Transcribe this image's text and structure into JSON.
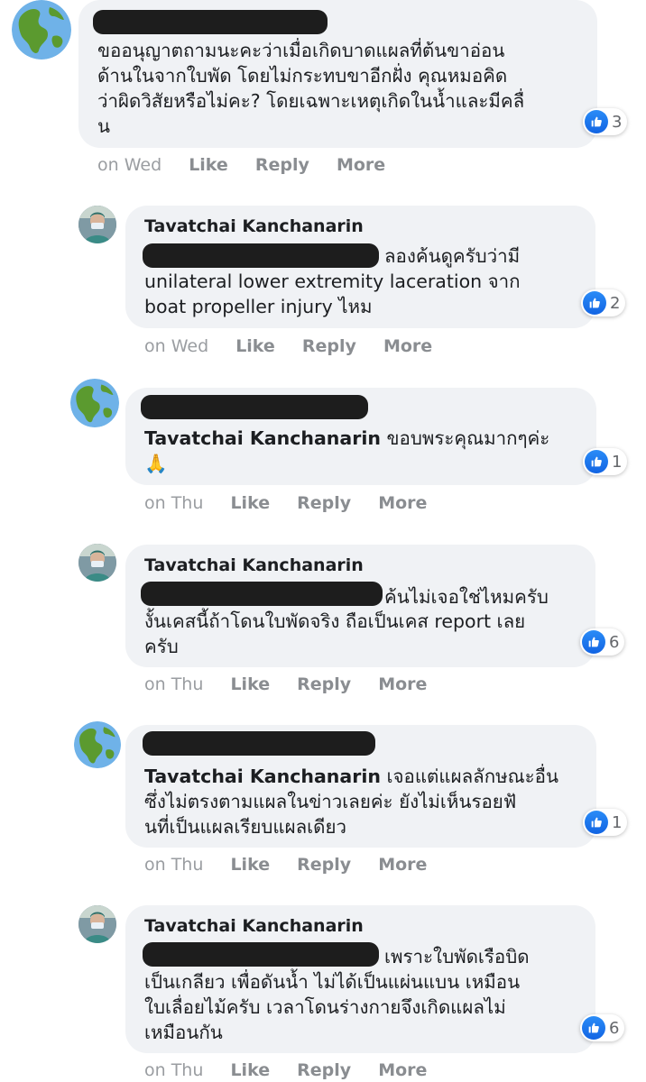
{
  "comments": [
    {
      "author": "",
      "lines": [
        "ขออนุญาตถามนะคะว่าเมื่อเกิดบาดแผลที่ต้นขาอ่อน",
        "ด้านในจากใบพัด โดยไม่กระทบขาอีกฝั่ง คุณหมอคิด",
        "ว่าผิดวิสัยหรือไม่คะ? โดยเฉพาะเหตุเกิดในน้ำและมีคลื่",
        "น"
      ],
      "reactions": "3",
      "time": "on Wed"
    },
    {
      "author": "Tavatchai Kanchanarin",
      "lines": [
        "ลองค้นดูครับว่ามี",
        "unilateral lower extremity laceration จาก",
        "boat propeller injury ไหม"
      ],
      "reactions": "2",
      "time": "on Wed"
    },
    {
      "author": "",
      "mention": "Tavatchai Kanchanarin",
      "lines": [
        "ขอบพระคุณมากๆค่ะ",
        "🙏"
      ],
      "reactions": "1",
      "time": "on Thu"
    },
    {
      "author": "Tavatchai Kanchanarin",
      "lines": [
        "ค้นไม่เจอใช่ไหมครับ",
        "งั้นเคสนี้ถ้าโดนใบพัดจริง ถือเป็นเคส report เลย",
        "ครับ"
      ],
      "reactions": "6",
      "time": "on Thu"
    },
    {
      "author": "",
      "mention": "Tavatchai Kanchanarin",
      "lines": [
        "เจอแต่แผลลักษณะอื่น",
        "ซึ่งไม่ตรงตามแผลในข่าวเลยค่ะ ยังไม่เห็นรอยฟั",
        "นที่เป็นแผลเรียบแผลเดียว"
      ],
      "reactions": "1",
      "time": "on Thu"
    },
    {
      "author": "Tavatchai Kanchanarin",
      "lines": [
        "เพราะใบพัดเรือบิด",
        "เป็นเกลียว เพื่อดันน้ำ ไม่ได้เป็นแผ่นแบน เหมือน",
        "ใบเลื่อยไม้ครับ เวลาโดนร่างกายจึงเกิดแผลไม่",
        "เหมือนกัน"
      ],
      "reactions": "6",
      "time": "on Thu"
    }
  ],
  "actions": {
    "like": "Like",
    "reply": "Reply",
    "more": "More"
  },
  "icons": {
    "like": "thumbs-up-icon",
    "avatar_globe": "globe-icon",
    "avatar_person": "person-photo"
  },
  "colors": {
    "bubble": "#f0f2f5",
    "like_blue": "#1877f2",
    "meta": "#8a8d91"
  }
}
